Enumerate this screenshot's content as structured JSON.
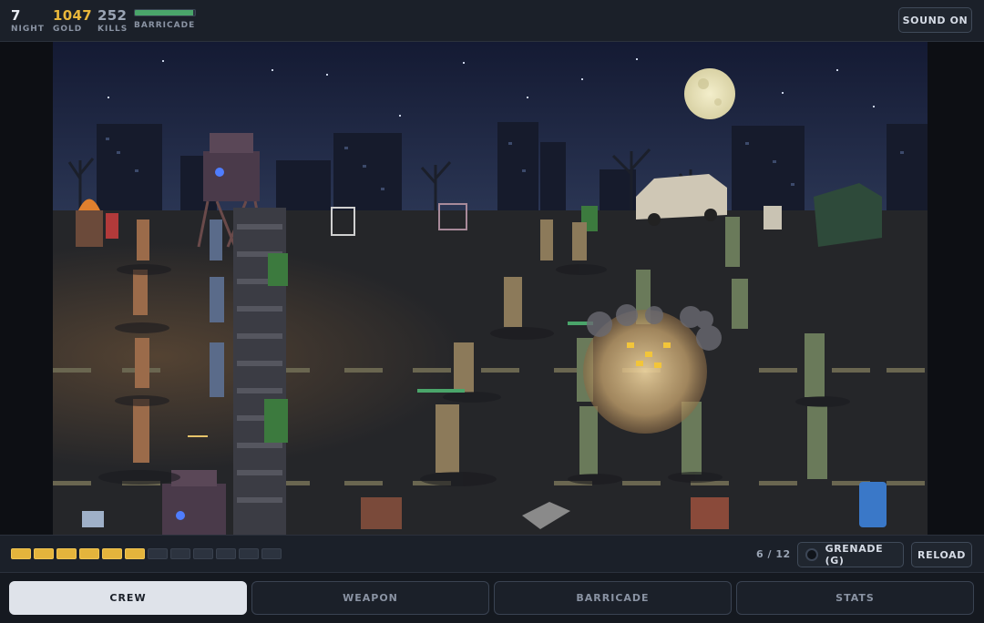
{
  "hud": {
    "night": {
      "value": "7",
      "label": "NIGHT"
    },
    "gold": {
      "value": "1047",
      "label": "GOLD"
    },
    "kills": {
      "value": "252",
      "label": "KILLS"
    },
    "barricade": {
      "label": "BARRICADE",
      "health_fraction": 0.97
    },
    "sound_button": "SOUND ON"
  },
  "ammo": {
    "magazine_total": 12,
    "magazine_loaded": 6,
    "count_text": "6 / 12",
    "grenade_button": "GRENADE (G)",
    "reload_button": "RELOAD"
  },
  "tabs": [
    {
      "label": "CREW",
      "active": true
    },
    {
      "label": "WEAPON",
      "active": false
    },
    {
      "label": "BARRICADE",
      "active": false
    },
    {
      "label": "STATS",
      "active": false
    }
  ],
  "colors": {
    "gold": "#e9b73b",
    "ammo_pip": "#e4b43c",
    "health": "#4aa56a",
    "sky": "#1a2140",
    "moon": "#ece6bf"
  }
}
